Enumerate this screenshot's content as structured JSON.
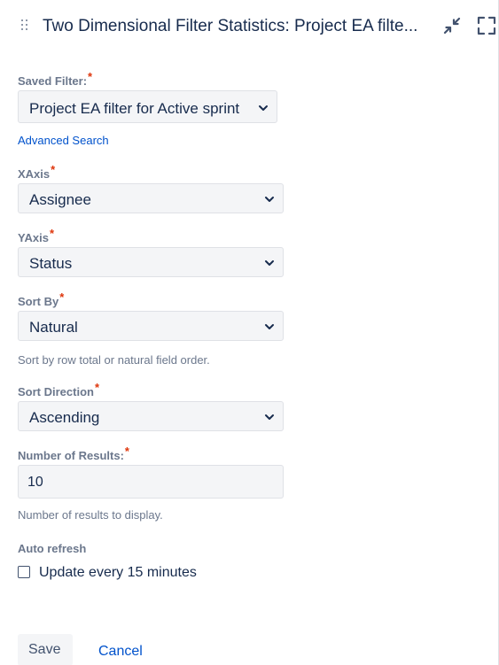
{
  "header": {
    "title": "Two Dimensional Filter Statistics: Project EA filte...",
    "drag_icon": "drag-handle-icon",
    "minimize_icon": "minimize-icon",
    "fullscreen_icon": "fullscreen-icon"
  },
  "form": {
    "saved_filter": {
      "label": "Saved Filter:",
      "required_mark": "*",
      "value": "Project EA filter for Active sprint"
    },
    "advanced_search_link": "Advanced Search",
    "xaxis": {
      "label": "XAxis",
      "required_mark": "*",
      "value": "Assignee"
    },
    "yaxis": {
      "label": "YAxis",
      "required_mark": "*",
      "value": "Status"
    },
    "sort_by": {
      "label": "Sort By",
      "required_mark": "*",
      "value": "Natural",
      "help": "Sort by row total or natural field order."
    },
    "sort_direction": {
      "label": "Sort Direction",
      "required_mark": "*",
      "value": "Ascending"
    },
    "number_of_results": {
      "label": "Number of Results:",
      "required_mark": "*",
      "value": "10",
      "help": "Number of results to display."
    },
    "auto_refresh": {
      "label": "Auto refresh",
      "checkbox_label": "Update every 15 minutes",
      "checked": false
    }
  },
  "actions": {
    "save_label": "Save",
    "cancel_label": "Cancel"
  },
  "colors": {
    "text": "#172b4d",
    "label": "#6b778c",
    "link": "#0052cc",
    "required": "#de350b",
    "field_bg": "#f4f5f7"
  }
}
